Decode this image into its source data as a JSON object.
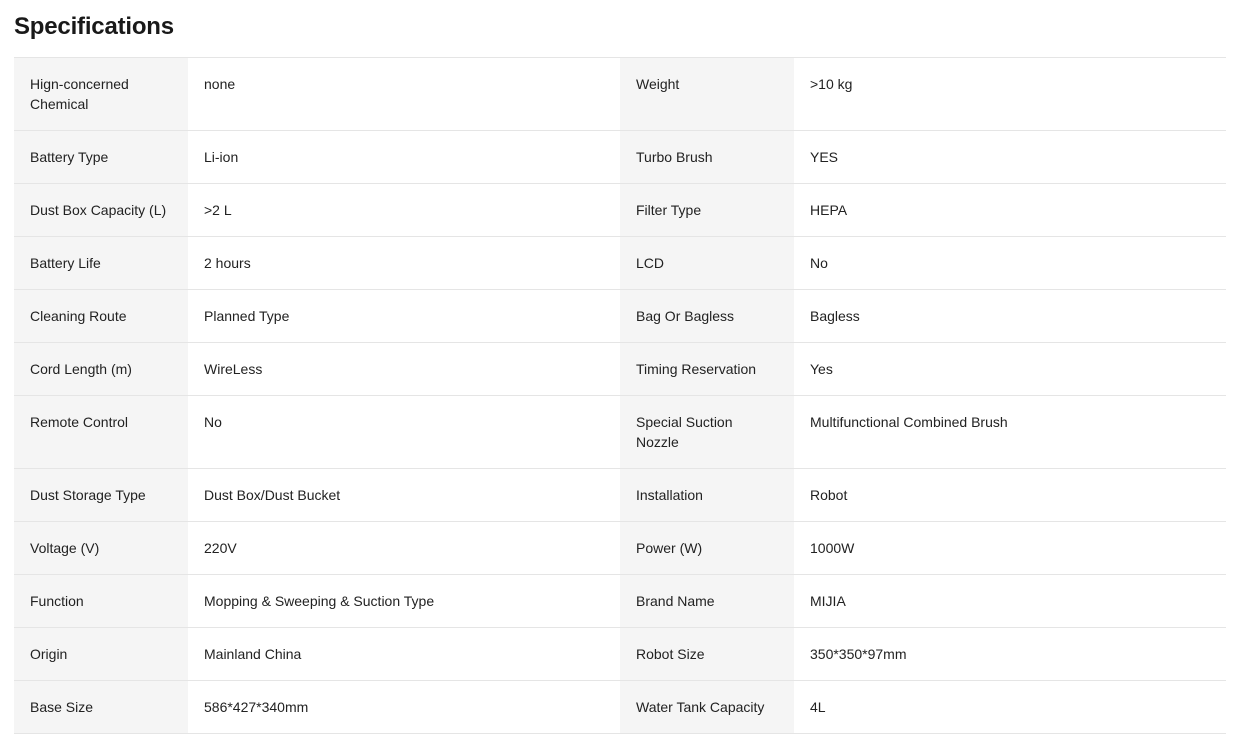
{
  "title": "Specifications",
  "rows": [
    {
      "k1": "Hign-concerned Chemical",
      "v1": "none",
      "k2": "Weight",
      "v2": ">10 kg"
    },
    {
      "k1": "Battery Type",
      "v1": "Li-ion",
      "k2": "Turbo Brush",
      "v2": "YES"
    },
    {
      "k1": "Dust Box Capacity (L)",
      "v1": ">2 L",
      "k2": "Filter Type",
      "v2": "HEPA"
    },
    {
      "k1": "Battery Life",
      "v1": "2 hours",
      "k2": "LCD",
      "v2": "No"
    },
    {
      "k1": "Cleaning Route",
      "v1": "Planned Type",
      "k2": "Bag Or Bagless",
      "v2": "Bagless"
    },
    {
      "k1": "Cord Length (m)",
      "v1": "WireLess",
      "k2": "Timing Reservation",
      "v2": "Yes"
    },
    {
      "k1": "Remote Control",
      "v1": "No",
      "k2": "Special Suction Nozzle",
      "v2": "Multifunctional Combined Brush"
    },
    {
      "k1": "Dust Storage Type",
      "v1": "Dust Box/Dust Bucket",
      "k2": "Installation",
      "v2": "Robot"
    },
    {
      "k1": "Voltage (V)",
      "v1": "220V",
      "k2": "Power (W)",
      "v2": "1000W"
    },
    {
      "k1": "Function",
      "v1": "Mopping & Sweeping & Suction Type",
      "k2": "Brand Name",
      "v2": "MIJIA"
    },
    {
      "k1": "Origin",
      "v1": "Mainland China",
      "k2": "Robot Size",
      "v2": "350*350*97mm"
    },
    {
      "k1": "Base Size",
      "v1": "586*427*340mm",
      "k2": "Water Tank Capacity",
      "v2": "4L"
    }
  ]
}
